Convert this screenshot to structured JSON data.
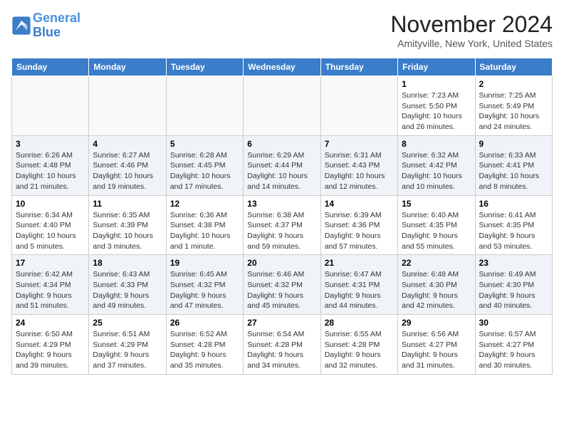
{
  "header": {
    "logo_line1": "General",
    "logo_line2": "Blue",
    "month": "November 2024",
    "location": "Amityville, New York, United States"
  },
  "weekdays": [
    "Sunday",
    "Monday",
    "Tuesday",
    "Wednesday",
    "Thursday",
    "Friday",
    "Saturday"
  ],
  "weeks": [
    [
      {
        "day": "",
        "info": ""
      },
      {
        "day": "",
        "info": ""
      },
      {
        "day": "",
        "info": ""
      },
      {
        "day": "",
        "info": ""
      },
      {
        "day": "",
        "info": ""
      },
      {
        "day": "1",
        "info": "Sunrise: 7:23 AM\nSunset: 5:50 PM\nDaylight: 10 hours and 26 minutes."
      },
      {
        "day": "2",
        "info": "Sunrise: 7:25 AM\nSunset: 5:49 PM\nDaylight: 10 hours and 24 minutes."
      }
    ],
    [
      {
        "day": "3",
        "info": "Sunrise: 6:26 AM\nSunset: 4:48 PM\nDaylight: 10 hours and 21 minutes."
      },
      {
        "day": "4",
        "info": "Sunrise: 6:27 AM\nSunset: 4:46 PM\nDaylight: 10 hours and 19 minutes."
      },
      {
        "day": "5",
        "info": "Sunrise: 6:28 AM\nSunset: 4:45 PM\nDaylight: 10 hours and 17 minutes."
      },
      {
        "day": "6",
        "info": "Sunrise: 6:29 AM\nSunset: 4:44 PM\nDaylight: 10 hours and 14 minutes."
      },
      {
        "day": "7",
        "info": "Sunrise: 6:31 AM\nSunset: 4:43 PM\nDaylight: 10 hours and 12 minutes."
      },
      {
        "day": "8",
        "info": "Sunrise: 6:32 AM\nSunset: 4:42 PM\nDaylight: 10 hours and 10 minutes."
      },
      {
        "day": "9",
        "info": "Sunrise: 6:33 AM\nSunset: 4:41 PM\nDaylight: 10 hours and 8 minutes."
      }
    ],
    [
      {
        "day": "10",
        "info": "Sunrise: 6:34 AM\nSunset: 4:40 PM\nDaylight: 10 hours and 5 minutes."
      },
      {
        "day": "11",
        "info": "Sunrise: 6:35 AM\nSunset: 4:39 PM\nDaylight: 10 hours and 3 minutes."
      },
      {
        "day": "12",
        "info": "Sunrise: 6:36 AM\nSunset: 4:38 PM\nDaylight: 10 hours and 1 minute."
      },
      {
        "day": "13",
        "info": "Sunrise: 6:38 AM\nSunset: 4:37 PM\nDaylight: 9 hours and 59 minutes."
      },
      {
        "day": "14",
        "info": "Sunrise: 6:39 AM\nSunset: 4:36 PM\nDaylight: 9 hours and 57 minutes."
      },
      {
        "day": "15",
        "info": "Sunrise: 6:40 AM\nSunset: 4:35 PM\nDaylight: 9 hours and 55 minutes."
      },
      {
        "day": "16",
        "info": "Sunrise: 6:41 AM\nSunset: 4:35 PM\nDaylight: 9 hours and 53 minutes."
      }
    ],
    [
      {
        "day": "17",
        "info": "Sunrise: 6:42 AM\nSunset: 4:34 PM\nDaylight: 9 hours and 51 minutes."
      },
      {
        "day": "18",
        "info": "Sunrise: 6:43 AM\nSunset: 4:33 PM\nDaylight: 9 hours and 49 minutes."
      },
      {
        "day": "19",
        "info": "Sunrise: 6:45 AM\nSunset: 4:32 PM\nDaylight: 9 hours and 47 minutes."
      },
      {
        "day": "20",
        "info": "Sunrise: 6:46 AM\nSunset: 4:32 PM\nDaylight: 9 hours and 45 minutes."
      },
      {
        "day": "21",
        "info": "Sunrise: 6:47 AM\nSunset: 4:31 PM\nDaylight: 9 hours and 44 minutes."
      },
      {
        "day": "22",
        "info": "Sunrise: 6:48 AM\nSunset: 4:30 PM\nDaylight: 9 hours and 42 minutes."
      },
      {
        "day": "23",
        "info": "Sunrise: 6:49 AM\nSunset: 4:30 PM\nDaylight: 9 hours and 40 minutes."
      }
    ],
    [
      {
        "day": "24",
        "info": "Sunrise: 6:50 AM\nSunset: 4:29 PM\nDaylight: 9 hours and 39 minutes."
      },
      {
        "day": "25",
        "info": "Sunrise: 6:51 AM\nSunset: 4:29 PM\nDaylight: 9 hours and 37 minutes."
      },
      {
        "day": "26",
        "info": "Sunrise: 6:52 AM\nSunset: 4:28 PM\nDaylight: 9 hours and 35 minutes."
      },
      {
        "day": "27",
        "info": "Sunrise: 6:54 AM\nSunset: 4:28 PM\nDaylight: 9 hours and 34 minutes."
      },
      {
        "day": "28",
        "info": "Sunrise: 6:55 AM\nSunset: 4:28 PM\nDaylight: 9 hours and 32 minutes."
      },
      {
        "day": "29",
        "info": "Sunrise: 6:56 AM\nSunset: 4:27 PM\nDaylight: 9 hours and 31 minutes."
      },
      {
        "day": "30",
        "info": "Sunrise: 6:57 AM\nSunset: 4:27 PM\nDaylight: 9 hours and 30 minutes."
      }
    ]
  ]
}
